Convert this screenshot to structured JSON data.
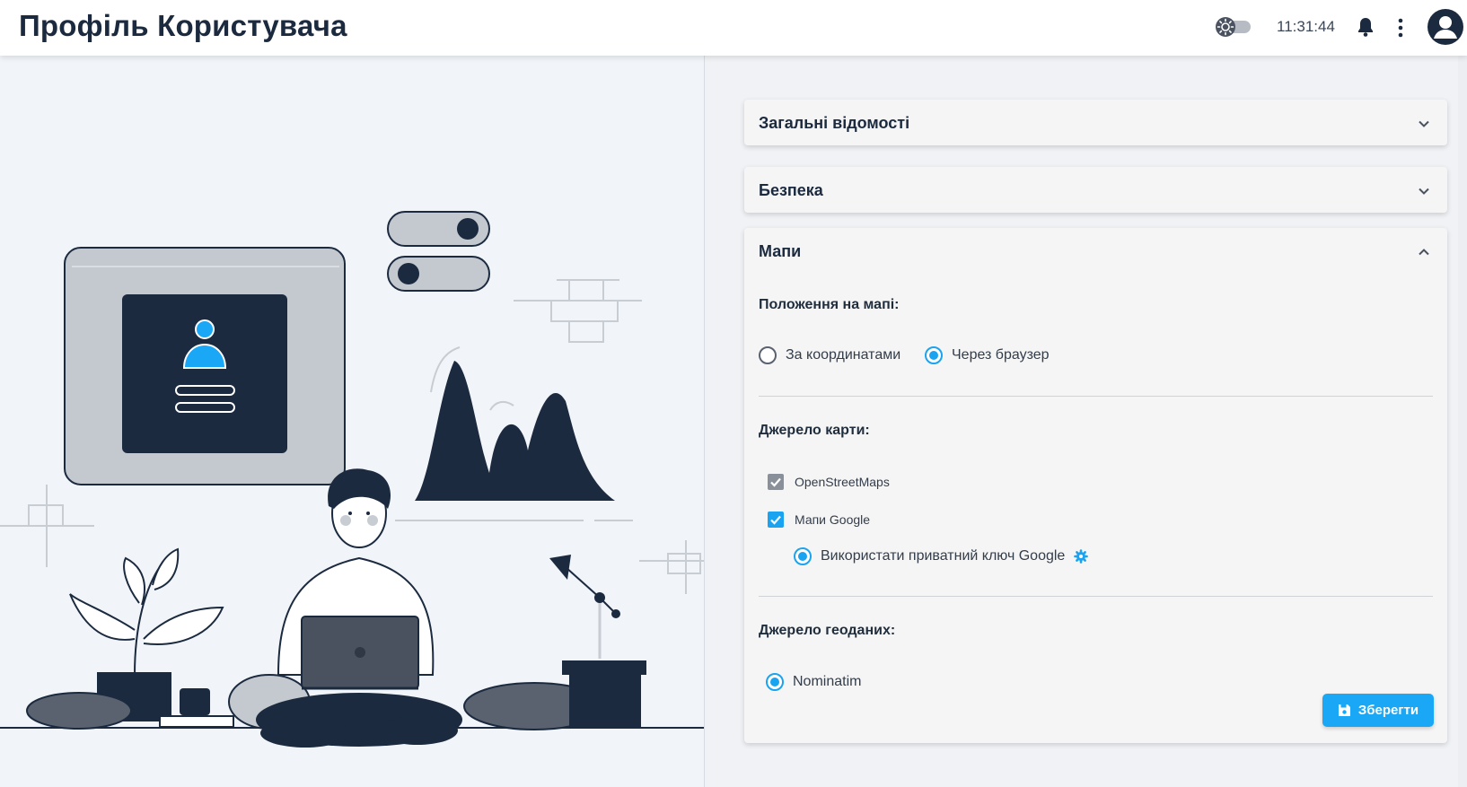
{
  "header": {
    "title": "Профіль Користувача",
    "time": "11:31:44",
    "icons": [
      "theme-toggle-icon",
      "bell-icon",
      "kebab-menu-icon",
      "user-avatar-icon"
    ]
  },
  "panels": {
    "general": {
      "title": "Загальні відомості",
      "expanded": false
    },
    "security": {
      "title": "Безпека",
      "expanded": false
    },
    "maps": {
      "title": "Мапи",
      "expanded": true,
      "position_label": "Положення на мапі:",
      "position_options": [
        {
          "label": "За координатами",
          "selected": false
        },
        {
          "label": "Через браузер",
          "selected": true
        }
      ],
      "source_label": "Джерело карти:",
      "sources": [
        {
          "label": "OpenStreetMaps",
          "checked": true,
          "color": "#8a9099"
        },
        {
          "label": "Мапи Google",
          "checked": true,
          "color": "#1aa3f0"
        }
      ],
      "google_key_option": {
        "label": "Використати приватний ключ Google",
        "selected": true
      },
      "geodata_label": "Джерело геоданих:",
      "geodata_option": {
        "label": "Nominatim",
        "selected": true
      },
      "save_label": "Зберегти"
    }
  },
  "colors": {
    "accent": "#1aa3f0",
    "navy": "#1b2a3f",
    "panel_bg": "#f5f5f5"
  }
}
